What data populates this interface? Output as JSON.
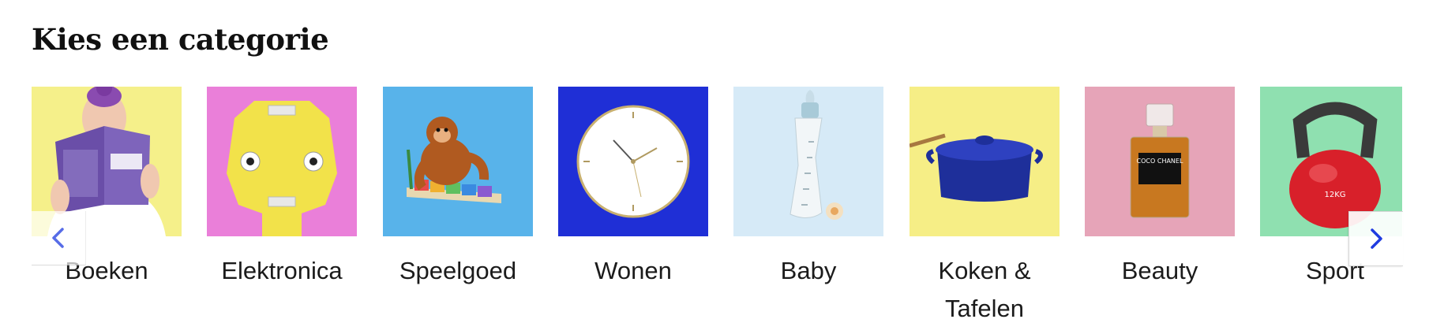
{
  "section": {
    "title": "Kies een categorie"
  },
  "categories": [
    {
      "label": "Boeken",
      "icon": "book-icon",
      "bg": "#f5f08a"
    },
    {
      "label": "Elektronica",
      "icon": "plug-socket-icon",
      "bg": "#ea7fd9"
    },
    {
      "label": "Speelgoed",
      "icon": "toy-monkey-icon",
      "bg": "#58b3ea"
    },
    {
      "label": "Wonen",
      "icon": "wall-clock-icon",
      "bg": "#1f2fd6"
    },
    {
      "label": "Baby",
      "icon": "baby-bottle-icon",
      "bg": "#d6eaf7"
    },
    {
      "label": "Koken & Tafelen",
      "icon": "cooking-pot-icon",
      "bg": "#f6ee86"
    },
    {
      "label": "Beauty",
      "icon": "perfume-bottle-icon",
      "bg": "#e6a4b8"
    },
    {
      "label": "Sport",
      "icon": "kettlebell-icon",
      "bg": "#8fe0b0"
    }
  ],
  "images": {
    "perfume_label": "COCO CHANEL",
    "kettlebell_label": "12KG"
  },
  "navigation": {
    "prev_icon": "chevron-left-icon",
    "next_icon": "chevron-right-icon",
    "accent": "#1f3be0"
  }
}
